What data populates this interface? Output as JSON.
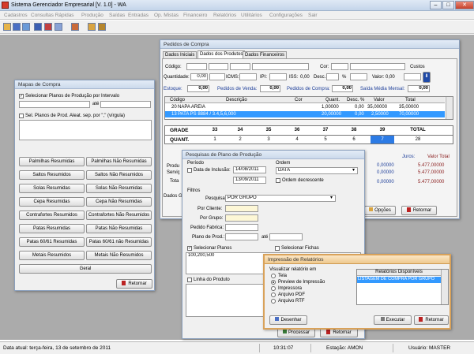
{
  "window": {
    "title": "Sistema Gerenciador Empresarial [V. 1.0] - WA"
  },
  "menu": [
    "Cadastros",
    "Consultas Rápidas",
    "Produção",
    "Saídas",
    "Entradas",
    "Op. Mistas",
    "Financeiro",
    "Relatórios",
    "Utilitários",
    "Configurações",
    "Sair"
  ],
  "status": {
    "date": "Data atual: terça-feira, 13 de setembro de 2011",
    "time": "10:31:07",
    "station": "Estação: AMON",
    "user": "Usuário: MASTER"
  },
  "mapas": {
    "title": "Mapas de Compra",
    "chk_planos": "Selecionar Planos de Produção por Intervalo",
    "ate": "até",
    "chk_aleat": "Sel. Planos de Prod. Aleat. sep. por \",\" (vírgula)",
    "buttons": [
      "Palmilhas Resumidas",
      "Palmilhas Não Resumidas",
      "Saltos Resumidos",
      "Saltos Não Resumidos",
      "Solas Resumidas",
      "Solas Não Resumidas",
      "Cepa Resumidas",
      "Cepa Não Resumidas",
      "Contrafortes Resumidos",
      "Contrafortes Não Resumidos",
      "Patas Resumidas",
      "Patas Não Resumidas",
      "Patas 60/61 Resumidas",
      "Patas 60/61 não Resumidas",
      "Metais Resumidos",
      "Metais Não Resumidos"
    ],
    "geral": "Geral",
    "retornar": "Retornar"
  },
  "pedidos": {
    "title": "Pedidos de Compra",
    "tabs": [
      "Dados Iniciais",
      "Dados dos Produtos",
      "Dados Financeiros"
    ],
    "lbl_codigo": "Código:",
    "lbl_cor": "Cor:",
    "lbl_custos": "Custos",
    "lbl_quant": "Quantidade:",
    "val_quant": "0,00",
    "lbl_icms": "ICMS:",
    "lbl_ipi": "IPI:",
    "lbl_iss": "ISS:",
    "val_zero": "0,00",
    "lbl_desc": "Desc.:",
    "lbl_pct": "%",
    "lbl_valor": "Valor:",
    "lbl_estoque": "Estoque:",
    "val_estoque": "0,00",
    "lbl_venda": "Pedidos de Venda:",
    "val_venda": "0,00",
    "lbl_compra": "Pedidos de Compra:",
    "val_compra": "0,00",
    "lbl_saida": "Saída Média Mensal:",
    "val_saida": "0,00",
    "table_headers": [
      "Código",
      "Descrição",
      "Cor",
      "Quant.",
      "Desc. %",
      "Valor",
      "Total"
    ],
    "rows": [
      [
        "20",
        "NAPA AREIA",
        "",
        "1,00000",
        "0,00",
        "35,00000",
        "35,00000"
      ],
      [
        "13",
        "PATA PS 8884 / 3.4,5,6,000",
        "",
        "20,00000",
        "0,00",
        "2,50000",
        "70,00000"
      ]
    ],
    "grade_label": "GRADE",
    "grade": [
      "33",
      "34",
      "35",
      "36",
      "37",
      "38",
      "39"
    ],
    "total_label": "TOTAL",
    "quant_label": "QUANT.",
    "quant": [
      "1",
      "2",
      "3",
      "4",
      "5",
      "6",
      "7"
    ],
    "quant_total": "28",
    "juros": "Juros:",
    "valor_total": "Valor Total",
    "fin_rows": [
      [
        "0,00000",
        "5.477,00000"
      ],
      [
        "0,00000",
        "5.477,00000"
      ],
      [
        "0,00000",
        "5.477,00000"
      ]
    ],
    "left_labels": [
      "Produ",
      "Serviç",
      "Tota",
      "Dados G"
    ],
    "opcoes": "Opções",
    "retornar": "Retornar"
  },
  "pesquisas": {
    "title": "Pesquisas de Plano de Produção",
    "periodo": "Período",
    "chk_inclusao": "Data de Inclusão:",
    "date1": "14/08/2011",
    "date2": "13/09/2011",
    "ordem": "Ordem",
    "ordem_value": "DATA",
    "chk_decrescente": "Ordem decrescente",
    "filtros": "Filtros",
    "lbl_pesquisa": "Pesquisa:",
    "pesquisa_value": "POR GRUPO",
    "lbl_cliente": "Por Cliente:",
    "lbl_grupo": "Por Grupo:",
    "lbl_fabrica": "Pedido Fabrica:",
    "lbl_plano": "Plano de Prod.:",
    "ate": "até",
    "chk_planos": "Selecionar Planos",
    "chk_fichas": "Selecionar Fichas",
    "planos_value": "100,200,500",
    "chk_linha": "Linha do Produto",
    "processar": "Processar",
    "retornar": "Retornar"
  },
  "impressao": {
    "title": "Impressão de Relatórios",
    "visualizar": "Visualizar relatório em",
    "options": [
      "Tela",
      "Preview de Impressão",
      "Impressora",
      "Arquivo PDF",
      "Arquivo RTF"
    ],
    "selected": 1,
    "disponiveis": "Relatórios Disponíveis",
    "report": "LISTAGEM DE COMPRA POR GRUPO",
    "desenhar": "Desenhar",
    "executar": "Executar",
    "retornar": "Retornar"
  },
  "colors": {
    "selection": "#3399ff",
    "grade_sel": "#2c7be5",
    "accent": "#1e3f9a"
  }
}
